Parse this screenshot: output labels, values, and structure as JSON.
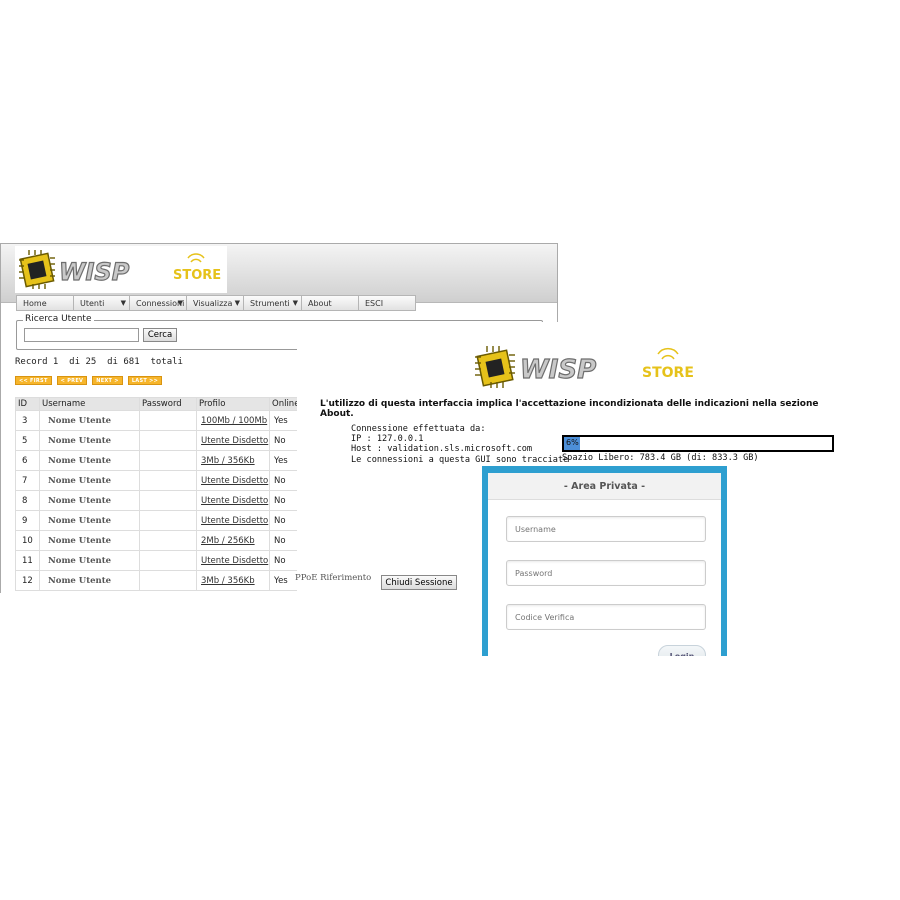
{
  "colors": {
    "accent_blue": "#2e9fd0",
    "pager_orange": "#f6b52b",
    "disk_fill": "#4d8fd8"
  },
  "left": {
    "brand": "WISP",
    "brand_suffix": "STORE",
    "nav": [
      {
        "label": "Home",
        "has_menu": false
      },
      {
        "label": "Utenti",
        "has_menu": true
      },
      {
        "label": "Connessioni",
        "has_menu": true
      },
      {
        "label": "Visualizza",
        "has_menu": true
      },
      {
        "label": "Strumenti",
        "has_menu": true
      },
      {
        "label": "About",
        "has_menu": false
      },
      {
        "label": "ESCI",
        "has_menu": false
      }
    ],
    "search": {
      "legend": "Ricerca Utente",
      "value": "",
      "button": "Cerca"
    },
    "record_info": "Record 1  di 25  di 681  totali",
    "pager": {
      "first": "<< FIRST",
      "prev": "< PREV",
      "next": "NEXT >",
      "last": "LAST >>"
    },
    "table": {
      "headers": [
        "ID",
        "Username",
        "Password",
        "Profilo",
        "Online"
      ],
      "rows": [
        {
          "id": "3",
          "username": "Nome Utente",
          "password": "",
          "profile": "100Mb / 100Mb",
          "online": "Yes"
        },
        {
          "id": "5",
          "username": "Nome Utente",
          "password": "",
          "profile": "Utente Disdetto",
          "online": "No"
        },
        {
          "id": "6",
          "username": "Nome Utente",
          "password": "",
          "profile": "3Mb / 356Kb",
          "online": "Yes"
        },
        {
          "id": "7",
          "username": "Nome Utente",
          "password": "",
          "profile": "Utente Disdetto",
          "online": "No"
        },
        {
          "id": "8",
          "username": "Nome Utente",
          "password": "",
          "profile": "Utente Disdetto",
          "online": "No"
        },
        {
          "id": "9",
          "username": "Nome Utente",
          "password": "",
          "profile": "Utente Disdetto",
          "online": "No"
        },
        {
          "id": "10",
          "username": "Nome Utente",
          "password": "",
          "profile": "2Mb / 256Kb",
          "online": "No"
        },
        {
          "id": "11",
          "username": "Nome Utente",
          "password": "",
          "profile": "Utente Disdetto",
          "online": "No"
        },
        {
          "id": "12",
          "username": "Nome Utente",
          "password": "",
          "profile": "3Mb / 356Kb",
          "online": "Yes"
        }
      ],
      "row12_reference": "PPoE Riferimento",
      "row12_button": "Chiudi Sessione"
    }
  },
  "right": {
    "brand": "WISP",
    "brand_suffix": "STORE",
    "disclaimer": "L'utilizzo di questa interfaccia implica l'accettazione incondizionata delle indicazioni nella sezione About.",
    "connection": {
      "title": "Connessione effettuata da:",
      "ip": "IP : 127.0.0.1",
      "host": "Host : validation.sls.microsoft.com",
      "tracked": "Le connessioni a questa GUI sono tracciate"
    },
    "disk": {
      "percent_label": "6%",
      "percent_value": 6,
      "free": "Spazio Libero: 783.4 GB (di: 833.3 GB)"
    },
    "login": {
      "title": "- Area Privata -",
      "username_placeholder": "Username",
      "password_placeholder": "Password",
      "code_placeholder": "Codice Verifica",
      "button": "Login"
    }
  }
}
